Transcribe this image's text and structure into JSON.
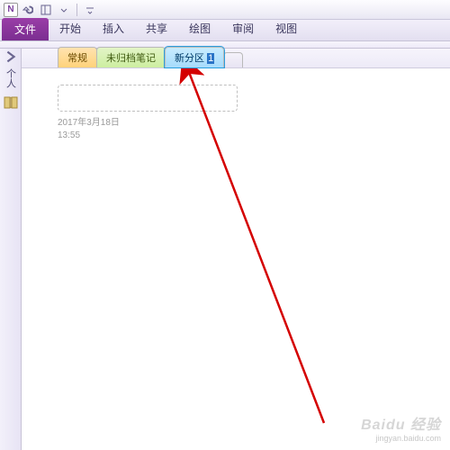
{
  "titlebar": {
    "app_abbrev": "N"
  },
  "ribbon": {
    "file": "文件",
    "tabs": [
      "开始",
      "插入",
      "共享",
      "绘图",
      "审阅",
      "视图"
    ]
  },
  "nav": {
    "label": "个人"
  },
  "sections": {
    "tab1": "常规",
    "tab2": "未归档笔记",
    "tab3_prefix": "新分区 ",
    "tab3_selected": "1"
  },
  "page": {
    "date": "2017年3月18日",
    "time": "13:55"
  },
  "watermark": {
    "line1": "Baidu 经验",
    "line2": "jingyan.baidu.com"
  }
}
